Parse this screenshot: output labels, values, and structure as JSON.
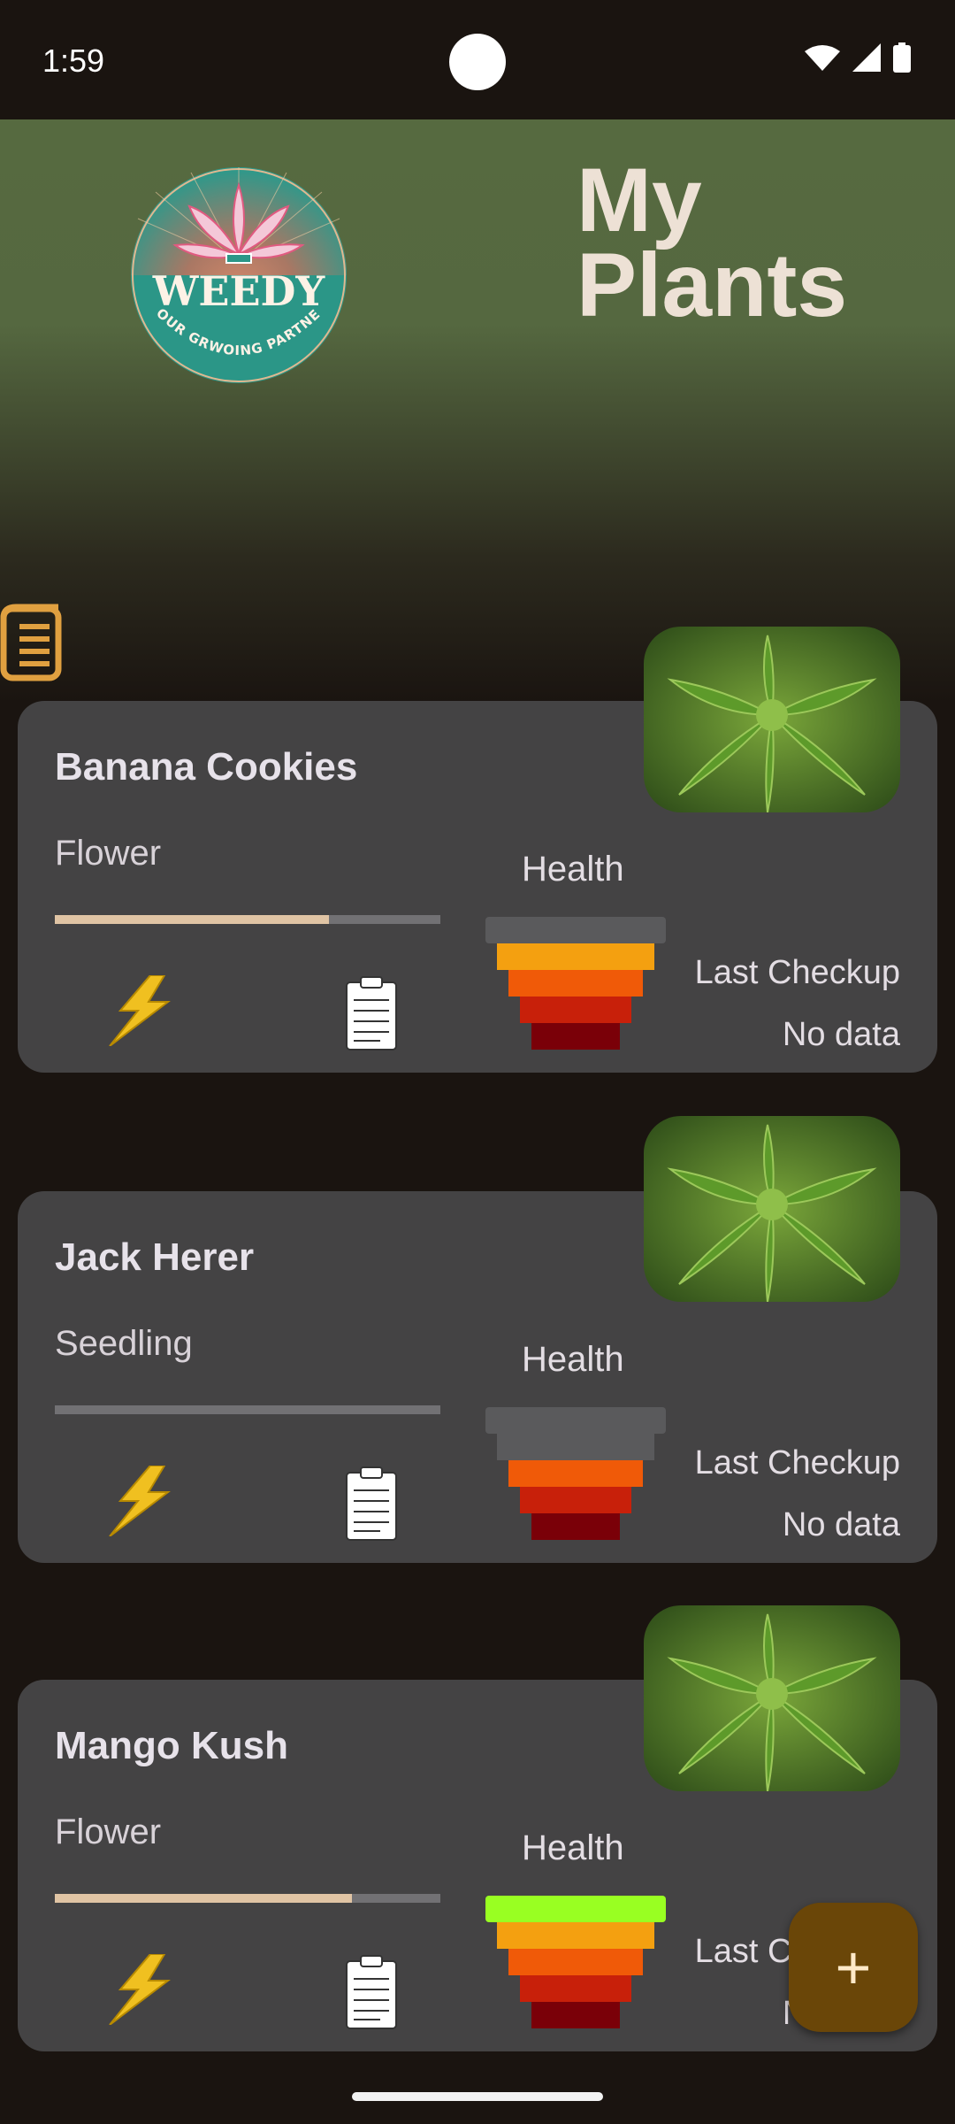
{
  "status_bar": {
    "time": "1:59",
    "icons": [
      "wifi-icon",
      "signal-icon",
      "battery-icon"
    ]
  },
  "header": {
    "title_line1": "My",
    "title_line2": "Plants",
    "logo": {
      "name": "WEEDY",
      "tagline": "YOUR GRWOING PARTNER"
    }
  },
  "plants": [
    {
      "name": "Banana Cookies",
      "stage": "Flower",
      "stage_progress": 0.71,
      "health_label": "Health",
      "health_level": 4,
      "last_checkup_label": "Last Checkup",
      "last_checkup_value": "No data"
    },
    {
      "name": "Jack Herer",
      "stage": "Seedling",
      "stage_progress": 0.0,
      "health_label": "Health",
      "health_level": 3,
      "last_checkup_label": "Last Checkup",
      "last_checkup_value": "No data"
    },
    {
      "name": "Mango Kush",
      "stage": "Flower",
      "stage_progress": 0.77,
      "health_label": "Health",
      "health_level": 5,
      "last_checkup_label": "Last Checkup",
      "last_checkup_value": "No data"
    }
  ],
  "fab": {
    "label": "+"
  },
  "colors": {
    "accent": "#e0c4a4",
    "card": "#444344",
    "fab": "#6a4608",
    "background": "#1a1410"
  }
}
